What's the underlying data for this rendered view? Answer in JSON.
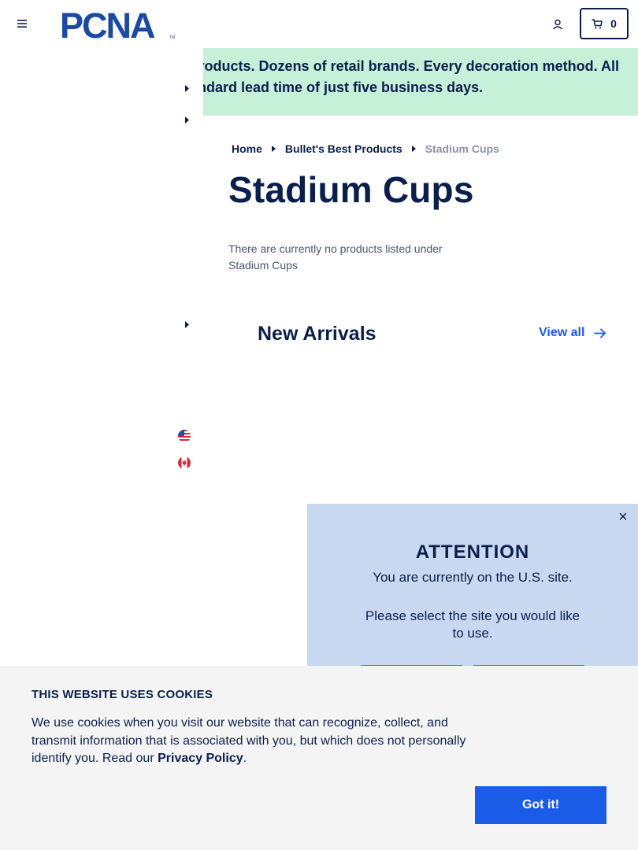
{
  "header": {
    "logo_text": "PCNA",
    "cart_count": "0"
  },
  "promo": {
    "line1": "Products. Dozens of retail brands. Every decoration method. All",
    "line2": "standard lead time of just five business days."
  },
  "breadcrumb": {
    "items": [
      "Home",
      "Bullet's Best Products"
    ],
    "current": "Stadium Cups"
  },
  "page": {
    "title": "Stadium Cups",
    "empty_message": "There are currently no products listed under Stadium Cups"
  },
  "new_arrivals": {
    "title": "New Arrivals",
    "view_all": "View all"
  },
  "attention": {
    "title": "ATTENTION",
    "current_site": "You are currently on the U.S. site.",
    "select_prompt": "Please select the site you would like to use."
  },
  "cookie": {
    "title": "THIS WEBSITE USES COOKIES",
    "body": "We use cookies when you visit our website that can recognize, collect, and transmit information that is associated with you, but which does not personally identify you. Read our ",
    "link": "Privacy Policy",
    "period": ".",
    "button": "Got it!"
  },
  "colors": {
    "navy": "#0b1f4d",
    "promo_bg": "#c6f0d8",
    "attention_bg": "#c8d8f0",
    "accent_blue": "#1a5be8",
    "cookie_bg": "#f4f4f4"
  },
  "icons": {
    "menu": "hamburger-icon",
    "account": "user-icon",
    "cart": "cart-icon",
    "view_all": "arrow-right-icon",
    "close": "close-icon",
    "flag_us": "us-flag-icon",
    "flag_ca": "canada-flag-icon"
  }
}
